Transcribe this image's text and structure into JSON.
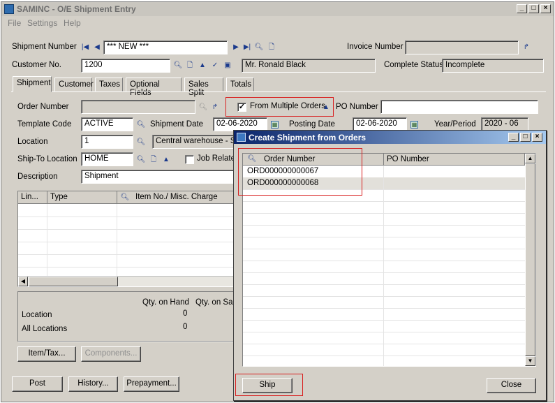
{
  "window": {
    "title": "SAMINC - O/E Shipment Entry"
  },
  "menu": {
    "file": "File",
    "settings": "Settings",
    "help": "Help"
  },
  "header": {
    "shipment_number_label": "Shipment Number",
    "shipment_number_value": "*** NEW ***",
    "invoice_number_label": "Invoice Number",
    "invoice_number_value": "",
    "customer_no_label": "Customer No.",
    "customer_no_value": "1200",
    "customer_name": "Mr. Ronald Black",
    "complete_status_label": "Complete Status",
    "complete_status_value": "Incomplete"
  },
  "tabs": [
    {
      "label": "Shipment"
    },
    {
      "label": "Customer"
    },
    {
      "label": "Taxes"
    },
    {
      "label": "Optional Fields"
    },
    {
      "label": "Sales Split"
    },
    {
      "label": "Totals"
    }
  ],
  "shipment": {
    "order_number_label": "Order Number",
    "order_number_value": "",
    "from_multiple_orders_label": "From Multiple Orders",
    "from_multiple_orders_checked": true,
    "po_number_label": "PO Number",
    "po_number_value": "",
    "template_code_label": "Template Code",
    "template_code_value": "ACTIVE",
    "shipment_date_label": "Shipment Date",
    "shipment_date_value": "02-06-2020",
    "posting_date_label": "Posting Date",
    "posting_date_value": "02-06-2020",
    "year_period_label": "Year/Period",
    "year_period_value": "2020 - 06",
    "location_label": "Location",
    "location_value": "1",
    "location_desc": "Central warehouse - Sea",
    "ship_to_label": "Ship-To Location",
    "ship_to_value": "HOME",
    "job_related_label": "Job Relate",
    "description_label": "Description",
    "description_value": "Shipment"
  },
  "detail_grid": {
    "columns": [
      "Lin...",
      "Type",
      "Item No./ Misc. Charge"
    ]
  },
  "qty": {
    "qty_on_hand_label": "Qty. on Hand",
    "qty_on_sale_label": "Qty. on Sale",
    "location_label": "Location",
    "location_qty": "0",
    "all_locations_label": "All Locations",
    "all_locations_qty": "0"
  },
  "buttons": {
    "item_tax": "Item/Tax...",
    "components": "Components...",
    "post": "Post",
    "history": "History...",
    "prepayment": "Prepayment..."
  },
  "dialog": {
    "title": "Create Shipment from Orders",
    "columns": [
      "Order Number",
      "PO Number"
    ],
    "rows": [
      {
        "order_number": "ORD000000000067",
        "po_number": ""
      },
      {
        "order_number": "ORD000000000068",
        "po_number": ""
      }
    ],
    "ship_button": "Ship",
    "close_button": "Close"
  },
  "colors": {
    "window_bg": "#d4d0c8",
    "dialog_title": "#0a246a",
    "highlight_box": "#d81e1e",
    "selected_row": "#e2e0da"
  }
}
